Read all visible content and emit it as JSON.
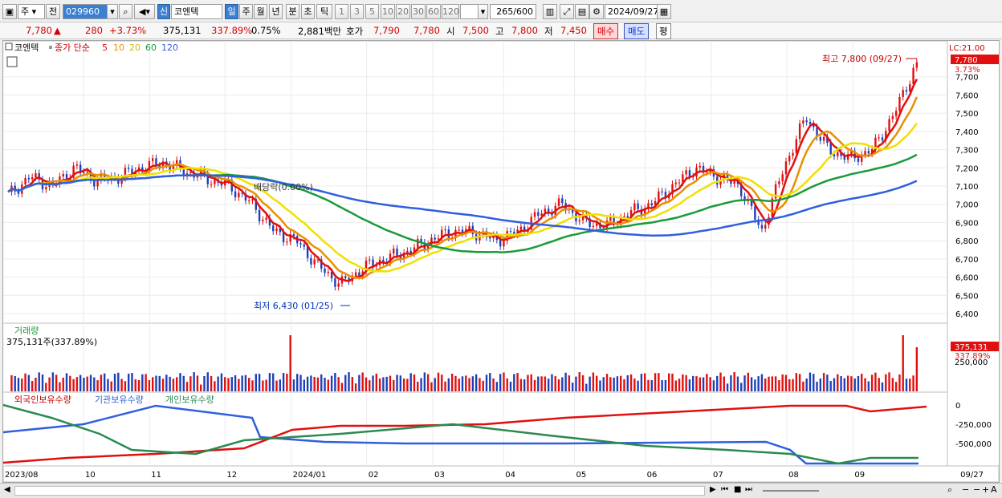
{
  "toolbar": {
    "market_label": "주",
    "prev_label": "전",
    "code_value": "029960",
    "new_label": "신",
    "name_value": "코엔텍",
    "periods": [
      "일",
      "주",
      "월",
      "년",
      "분",
      "초",
      "틱"
    ],
    "numbers": [
      "1",
      "3",
      "5",
      "10",
      "20",
      "30",
      "60",
      "120"
    ],
    "count_value": "265",
    "count_total": "/600",
    "date_value": "2024/09/27"
  },
  "quote": {
    "price": "7,780",
    "change_arrow": "▲",
    "change": "280",
    "change_pct": "+3.73%",
    "volume": "375,131",
    "volume_pct": "337.89%",
    "turnover_pct": "0.75%",
    "amount": "2,881백만",
    "hoga_label": "호가",
    "ask": "7,790",
    "bid": "7,780",
    "open_label": "시",
    "open": "7,500",
    "high_label": "고",
    "high": "7,800",
    "low_label": "저",
    "low": "7,450",
    "buy_label": "매수",
    "sell_label": "매도",
    "eval_label": "평"
  },
  "chart_data": [
    {
      "type": "line",
      "title": "코엔텍",
      "legend": {
        "label": "종가 단순",
        "periods": [
          "5",
          "10",
          "20",
          "60",
          "120"
        ],
        "colors": [
          "#e01010",
          "#e89000",
          "#f0e000",
          "#1a9a3a",
          "#2f5fe0"
        ]
      },
      "ylim": [
        6400,
        7800
      ],
      "yticks": [
        "7,700",
        "7,600",
        "7,500",
        "7,400",
        "7,300",
        "7,200",
        "7,100",
        "7,000",
        "6,900",
        "6,800",
        "6,700",
        "6,600",
        "6,500",
        "6,400"
      ],
      "x_labels": [
        "2023/08",
        "10",
        "11",
        "12",
        "2024/01",
        "02",
        "03",
        "04",
        "05",
        "06",
        "07",
        "08",
        "09",
        "09/27"
      ],
      "corner_label": "LC:21.00",
      "last_price_label": "7,780",
      "last_change_label": "3.73%",
      "high_annotation": "최고 7,800 (09/27)",
      "low_annotation": "최저 6,430 (01/25)",
      "ex_dividend_label": "배당락(0.00%)",
      "series": [
        {
          "name": "종가",
          "approx_closes": [
            7050,
            7150,
            7100,
            7200,
            7130,
            7150,
            7200,
            7230,
            7180,
            7140,
            7100,
            7000,
            6850,
            6800,
            6660,
            6560,
            6650,
            6700,
            6740,
            6800,
            6850,
            6850,
            6800,
            6850,
            6950,
            7000,
            6900,
            6880,
            6950,
            7000,
            7100,
            7200,
            7150,
            7100,
            6850,
            7200,
            7480,
            7300,
            7250,
            7300,
            7500,
            7780
          ]
        },
        {
          "name": "5",
          "color": "#e01010"
        },
        {
          "name": "10",
          "color": "#e89000"
        },
        {
          "name": "20",
          "color": "#f0e000"
        },
        {
          "name": "60",
          "color": "#1a9a3a"
        },
        {
          "name": "120",
          "color": "#2f5fe0"
        }
      ]
    },
    {
      "type": "bar",
      "title": "거래량",
      "volume_label": "375,131주(337.89%)",
      "last_volume_label": "375,131",
      "last_volume_pct_label": "337.89%",
      "ytick": "250,000"
    },
    {
      "type": "line",
      "series": [
        {
          "name": "외국인보유수량",
          "color": "#e01010"
        },
        {
          "name": "기관보유수량",
          "color": "#2f5fe0"
        },
        {
          "name": "개인보유수량",
          "color": "#2a8a50"
        }
      ],
      "yticks": [
        "0",
        "-250,000",
        "-500,000"
      ]
    }
  ]
}
